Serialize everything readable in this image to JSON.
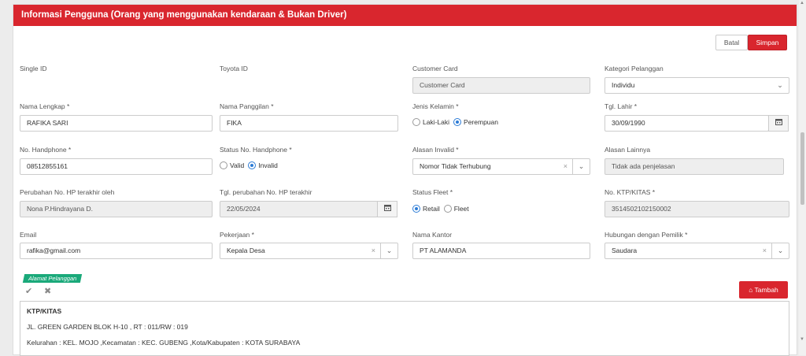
{
  "header": {
    "title": "Informasi Pengguna (Orang yang menggunakan kendaraan & Bukan Driver)"
  },
  "actions": {
    "cancel": "Batal",
    "save": "Simpan"
  },
  "fields": {
    "single_id": {
      "label": "Single ID"
    },
    "toyota_id": {
      "label": "Toyota ID"
    },
    "customer_card": {
      "label": "Customer Card",
      "placeholder": "Customer Card"
    },
    "kategori": {
      "label": "Kategori Pelanggan",
      "value": "Individu"
    },
    "nama_lengkap": {
      "label": "Nama Lengkap *",
      "value": "RAFIKA SARI"
    },
    "nama_panggilan": {
      "label": "Nama Panggilan *",
      "value": "FIKA"
    },
    "jenis_kelamin": {
      "label": "Jenis Kelamin *",
      "option1": "Laki-Laki",
      "option2": "Perempuan",
      "selected": "Perempuan"
    },
    "tgl_lahir": {
      "label": "Tgl. Lahir *",
      "value": "30/09/1990"
    },
    "no_hp": {
      "label": "No. Handphone *",
      "value": "08512855161"
    },
    "status_hp": {
      "label": "Status No. Handphone *",
      "option1": "Valid",
      "option2": "Invalid",
      "selected": "Invalid"
    },
    "alasan_invalid": {
      "label": "Alasan Invalid *",
      "value": "Nomor Tidak Terhubung"
    },
    "alasan_lainnya": {
      "label": "Alasan Lainnya",
      "placeholder": "Tidak ada penjelasan"
    },
    "perubahan_hp_oleh": {
      "label": "Perubahan No. HP terakhir oleh",
      "value": "Nona P.Hindrayana D."
    },
    "tgl_perubahan_hp": {
      "label": "Tgl. perubahan No. HP terakhir",
      "value": "22/05/2024"
    },
    "status_fleet": {
      "label": "Status Fleet *",
      "option1": "Retail",
      "option2": "Fleet",
      "selected": "Retail"
    },
    "no_ktp": {
      "label": "No. KTP/KITAS *",
      "value": "3514502102150002"
    },
    "email": {
      "label": "Email",
      "value": "rafika@gmail.com"
    },
    "pekerjaan": {
      "label": "Pekerjaan *",
      "value": "Kepala Desa"
    },
    "nama_kantor": {
      "label": "Nama Kantor",
      "value": "PT ALAMANDA"
    },
    "hubungan": {
      "label": "Hubungan dengan Pemilik *",
      "value": "Saudara"
    }
  },
  "address_section": {
    "tag": "Alamat Pelanggan",
    "add_button": "Tambah",
    "title": "KTP/KITAS",
    "line1": "JL. GREEN GARDEN BLOK H-10 , RT : 011/RW : 019",
    "line2": "Kelurahan : KEL. MOJO ,Kecamatan : KEC. GUBENG ,Kota/Kabupaten : KOTA SURABAYA"
  },
  "icons": {
    "calendar": "calendar-icon",
    "check": "check-icon",
    "close": "close-icon",
    "home": "home-icon"
  },
  "colors": {
    "accent": "#d9262e",
    "tag": "#1aa97a",
    "radio": "#2b7bd6"
  }
}
